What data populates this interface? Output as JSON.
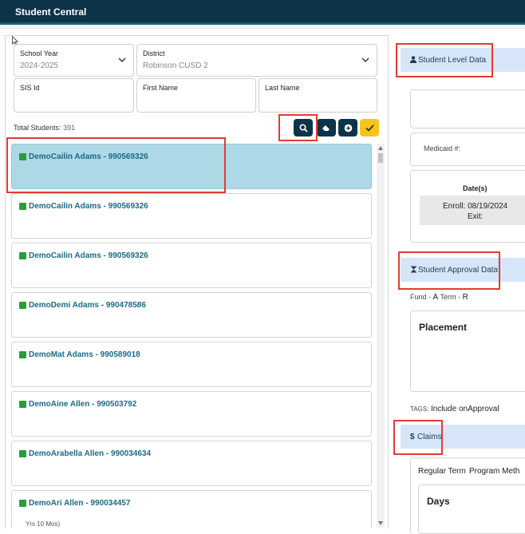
{
  "app": {
    "title": "Student Central"
  },
  "filters": {
    "school_year_label": "School Year",
    "school_year_value": "2024-2025",
    "district_label": "District",
    "district_value": "Robinson CUSD 2",
    "sis_label": "SIS Id",
    "first_name_label": "First Name",
    "last_name_label": "Last Name"
  },
  "total": {
    "label": "Total Students:",
    "count": "391"
  },
  "students": [
    "DemoCailin Adams - 990569326",
    "DemoCailin Adams - 990569326",
    "DemoCailin Adams - 990569326",
    "DemoDemi Adams - 990478586",
    "DemoMat Adams - 990589018",
    "DemoAine Allen - 990503792",
    "DemoArabella Allen - 990034634",
    "DemoAri Allen - 990034457"
  ],
  "partial_text": "Yrs 10 Mos)",
  "right": {
    "student_level": "Student Level Data",
    "medicaid_label": "Medicaid #:",
    "dates_header": "Date(s)",
    "enroll": "Enroll: 08/19/2024",
    "exit": "Exit:",
    "approval": "Student Approval Data",
    "fund_label": "Fund -",
    "fund_value": "A",
    "term_label": "Term -",
    "term_value": "R",
    "placement": "Placement",
    "tags_label": "TAGS:",
    "tags_value": "Include onApproval",
    "claims": "Claims",
    "regular_term": "Regular Term",
    "program_meth": "Program Meth",
    "days": "Days"
  },
  "colors": {
    "header": "#0d3349",
    "selected": "#add8e6",
    "accent_yellow": "#f5c518",
    "highlight": "#e53935"
  }
}
